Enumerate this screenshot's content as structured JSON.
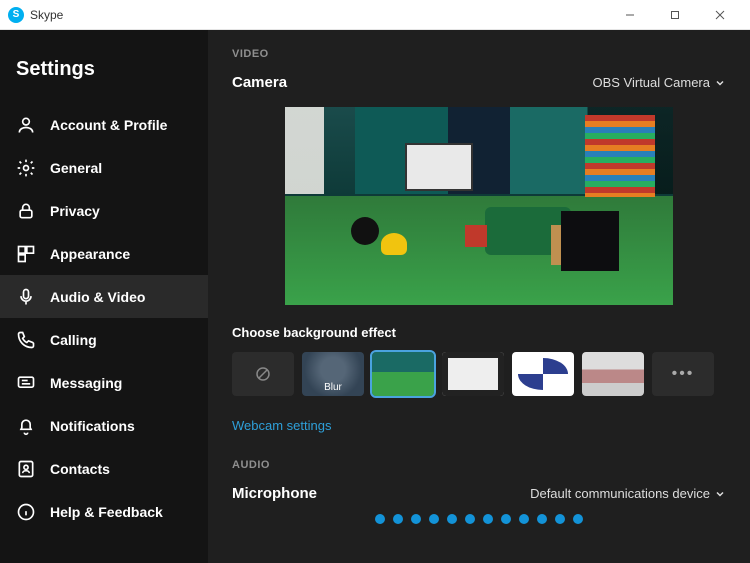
{
  "titlebar": {
    "app_name": "Skype"
  },
  "sidebar": {
    "heading": "Settings",
    "items": [
      {
        "label": "Account & Profile",
        "icon": "person-icon"
      },
      {
        "label": "General",
        "icon": "gear-icon"
      },
      {
        "label": "Privacy",
        "icon": "lock-icon"
      },
      {
        "label": "Appearance",
        "icon": "appearance-icon"
      },
      {
        "label": "Audio & Video",
        "icon": "microphone-icon",
        "active": true
      },
      {
        "label": "Calling",
        "icon": "phone-icon"
      },
      {
        "label": "Messaging",
        "icon": "message-icon"
      },
      {
        "label": "Notifications",
        "icon": "bell-icon"
      },
      {
        "label": "Contacts",
        "icon": "contacts-icon"
      },
      {
        "label": "Help & Feedback",
        "icon": "info-icon"
      }
    ]
  },
  "video": {
    "section_label": "VIDEO",
    "camera_label": "Camera",
    "camera_selected": "OBS Virtual Camera",
    "effects_label": "Choose background effect",
    "effects": {
      "none": "",
      "blur": "Blur"
    },
    "webcam_settings_link": "Webcam settings"
  },
  "audio": {
    "section_label": "AUDIO",
    "microphone_label": "Microphone",
    "microphone_selected": "Default communications device",
    "level_dots": 12
  }
}
